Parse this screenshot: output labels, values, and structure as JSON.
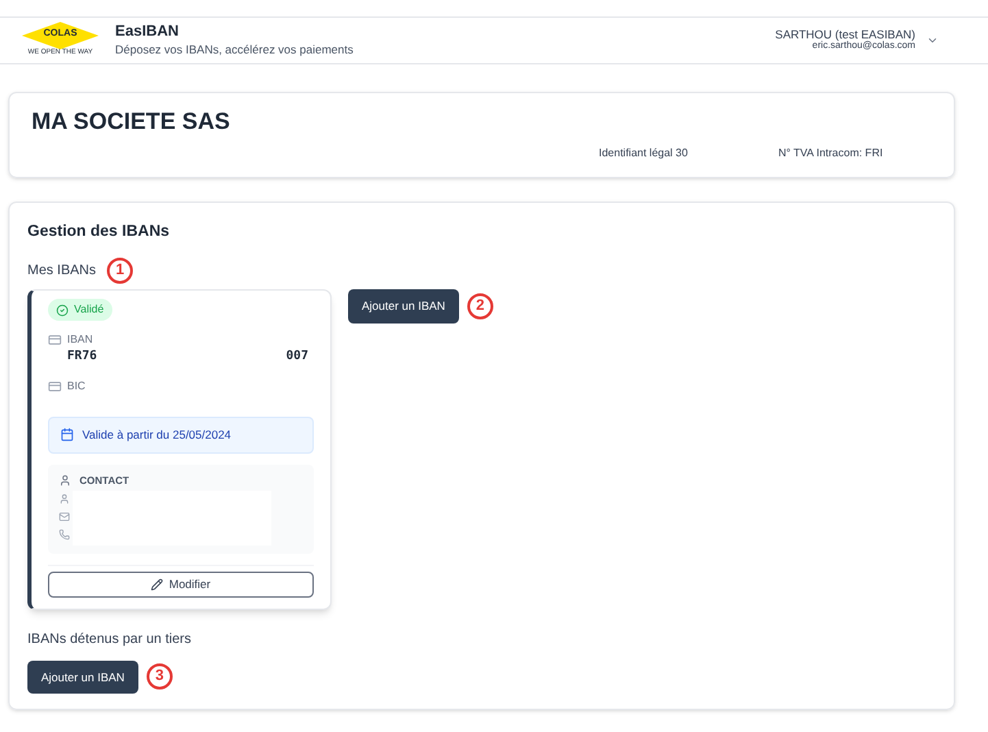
{
  "header": {
    "logo": {
      "name": "COLAS",
      "tagline": "WE OPEN THE WAY"
    },
    "app_name": "EasIBAN",
    "subtitle": "Déposez vos IBANs, accélérez vos paiements",
    "user": {
      "name": "SARTHOU (test EASIBAN)",
      "email": "eric.sarthou@colas.com"
    }
  },
  "company": {
    "name": "MA SOCIETE SAS",
    "legal_id": "Identifiant légal 30",
    "vat": "N° TVA Intracom: FRI"
  },
  "iban_management": {
    "title": "Gestion des IBANs",
    "my_ibans": {
      "label": "Mes IBANs",
      "marker": "1",
      "add_button": "Ajouter un IBAN",
      "add_marker": "2",
      "cards": [
        {
          "status": "Validé",
          "iban_label": "IBAN",
          "iban_start": "FR76",
          "iban_end": "007",
          "bic_label": "BIC",
          "valid_from": "Valide à partir du 25/05/2024",
          "contact_label": "CONTACT",
          "edit_button": "Modifier"
        }
      ]
    },
    "third_party": {
      "label": "IBANs détenus par un tiers",
      "add_button": "Ajouter un IBAN",
      "marker": "3"
    }
  }
}
